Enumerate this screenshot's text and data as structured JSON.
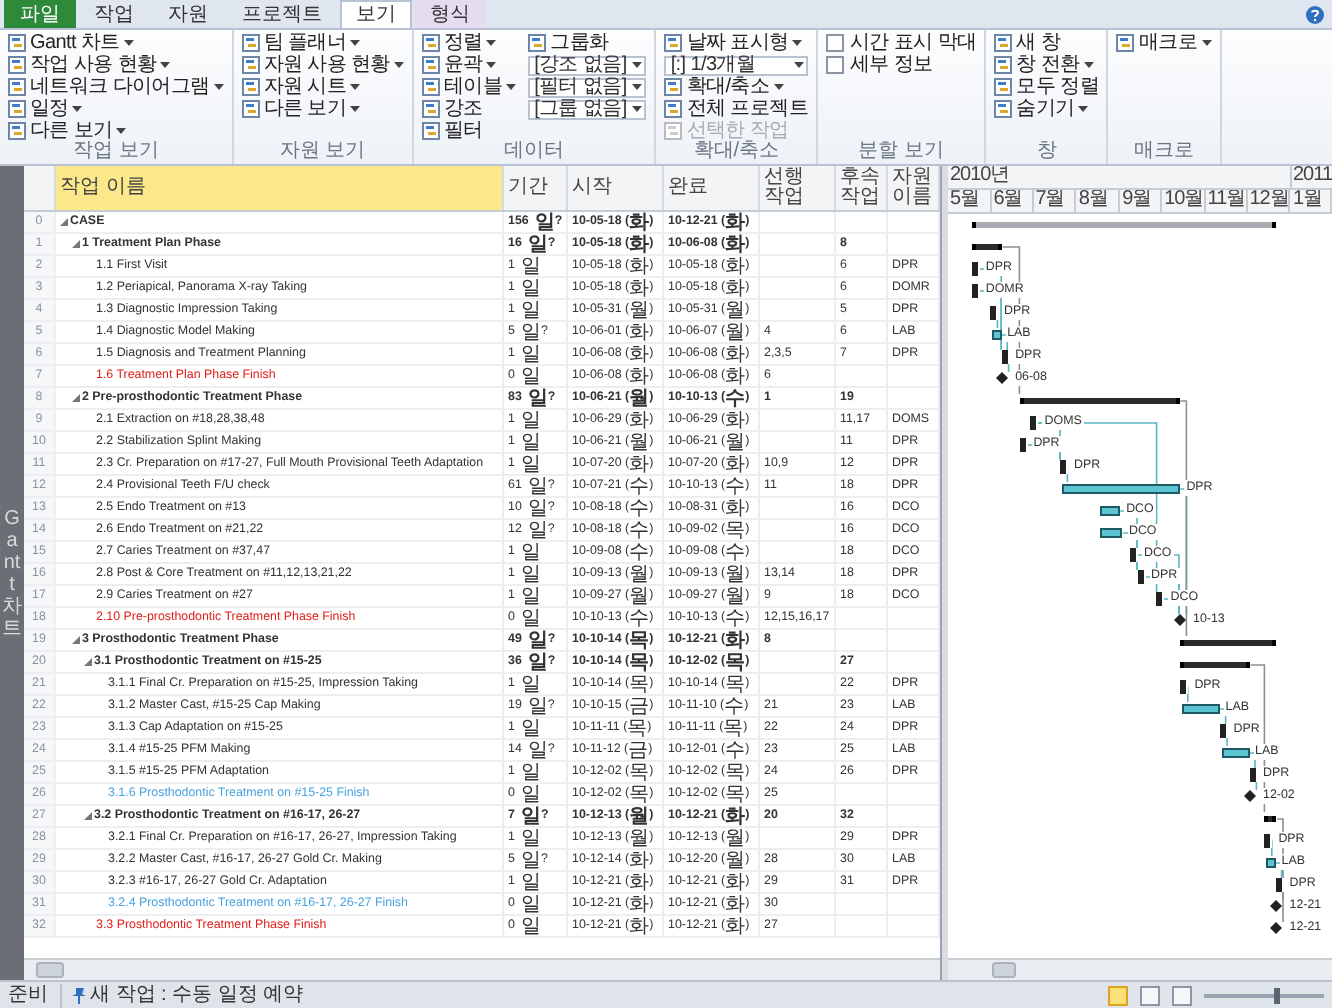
{
  "ribbon": {
    "tabs": [
      {
        "label": "파일",
        "kind": "file",
        "selected": false
      },
      {
        "label": "작업",
        "kind": "tab",
        "selected": false
      },
      {
        "label": "자원",
        "kind": "tab",
        "selected": false
      },
      {
        "label": "프로젝트",
        "kind": "tab",
        "selected": false
      },
      {
        "label": "보기",
        "kind": "tab",
        "selected": true
      },
      {
        "label": "형식",
        "kind": "contextual",
        "selected": false
      }
    ],
    "groups": [
      {
        "label": "작업 보기",
        "items": [
          {
            "label": "Gantt 차트",
            "kind": "dropdown",
            "disabled": false
          },
          {
            "label": "작업 사용 현황",
            "kind": "dropdown",
            "disabled": false
          },
          {
            "label": "네트워크 다이어그램",
            "kind": "dropdown",
            "disabled": false
          },
          {
            "label": "일정",
            "kind": "dropdown",
            "disabled": false
          },
          {
            "label": "다른 보기",
            "kind": "dropdown",
            "disabled": false
          }
        ]
      },
      {
        "label": "자원 보기",
        "items": [
          {
            "label": "팀 플래너",
            "kind": "dropdown",
            "disabled": false
          },
          {
            "label": "자원 사용 현황",
            "kind": "dropdown",
            "disabled": false
          },
          {
            "label": "자원 시트",
            "kind": "dropdown",
            "disabled": false
          },
          {
            "label": "다른 보기",
            "kind": "dropdown",
            "disabled": false
          }
        ]
      },
      {
        "label": "데이터",
        "items": [
          {
            "label": "정렬",
            "kind": "dropdown",
            "disabled": false
          },
          {
            "label": "윤곽",
            "kind": "dropdown",
            "disabled": false
          },
          {
            "label": "테이블",
            "kind": "dropdown",
            "disabled": false
          },
          {
            "label": "강조",
            "kind": "button",
            "disabled": false
          },
          {
            "label": "필터",
            "kind": "button",
            "disabled": false
          },
          {
            "label": "그룹화",
            "kind": "button",
            "disabled": false
          },
          {
            "label": "[강조 없음]",
            "kind": "field",
            "disabled": false
          },
          {
            "label": "[필터 없음]",
            "kind": "field",
            "disabled": false
          },
          {
            "label": "[그룹 없음]",
            "kind": "field",
            "disabled": false
          }
        ]
      },
      {
        "label": "확대/축소",
        "items": [
          {
            "label": "날짜 표시형",
            "kind": "dropdown",
            "disabled": false
          },
          {
            "label": "[:] 1/3개월",
            "kind": "field",
            "disabled": false
          },
          {
            "label": "확대/축소",
            "kind": "dropdown",
            "disabled": false
          },
          {
            "label": "전체 프로젝트",
            "kind": "button",
            "disabled": false
          },
          {
            "label": "선택한 작업",
            "kind": "button",
            "disabled": true
          }
        ]
      },
      {
        "label": "분할 보기",
        "items": [
          {
            "label": "시간 표시 막대",
            "kind": "checkbox",
            "checked": false,
            "disabled": false
          },
          {
            "label": "세부 정보",
            "kind": "checkbox",
            "checked": false,
            "disabled": false
          }
        ]
      },
      {
        "label": "창",
        "items": [
          {
            "label": "새 창",
            "kind": "button",
            "disabled": false
          },
          {
            "label": "창 전환",
            "kind": "dropdown",
            "disabled": false
          },
          {
            "label": "모두 정렬",
            "kind": "button",
            "disabled": false
          },
          {
            "label": "숨기기",
            "kind": "dropdown",
            "disabled": false
          }
        ]
      },
      {
        "label": "매크로",
        "items": [
          {
            "label": "매크로",
            "kind": "dropdown",
            "disabled": false
          }
        ]
      }
    ]
  },
  "side_label": "Gantt 차트",
  "task_table": {
    "columns": [
      {
        "label": "작업 이름",
        "selected": true
      },
      {
        "label": "기간",
        "selected": false
      },
      {
        "label": "시작",
        "selected": false
      },
      {
        "label": "완료",
        "selected": false
      },
      {
        "label": "선행 작업",
        "selected": false
      },
      {
        "label": "후속 작업",
        "selected": false
      },
      {
        "label": "자원 이름",
        "selected": false
      }
    ],
    "rows": [
      {
        "id": "0",
        "name": "CASE",
        "kind": "summary",
        "expanded": true,
        "duration": "156 일?",
        "start": "10-05-18 (화)",
        "finish": "10-12-21 (화)",
        "children": [
          {
            "id": "1",
            "name": "1 Treatment Plan Phase",
            "kind": "summary",
            "expanded": true,
            "duration": "16 일?",
            "start": "10-05-18 (화)",
            "finish": "10-06-08 (화)",
            "successors": "8",
            "children": [
              {
                "id": "2",
                "name": "1.1 First Visit",
                "kind": "task",
                "duration": "1 일",
                "start": "10-05-18 (화)",
                "finish": "10-05-18 (화)",
                "successors": "6",
                "resource": "DPR",
                "bar_label": "DPR"
              },
              {
                "id": "3",
                "name": "1.2 Periapical, Panorama X-ray Taking",
                "kind": "task",
                "duration": "1 일",
                "start": "10-05-18 (화)",
                "finish": "10-05-18 (화)",
                "successors": "6",
                "resource": "DOMR",
                "bar_label": "DOMR"
              },
              {
                "id": "4",
                "name": "1.3 Diagnostic Impression Taking",
                "kind": "task",
                "duration": "1 일",
                "start": "10-05-31 (월)",
                "finish": "10-05-31 (월)",
                "successors": "5",
                "resource": "DPR",
                "bar_label": "DPR"
              },
              {
                "id": "5",
                "name": "1.4 Diagnostic Model Making",
                "kind": "task",
                "duration": "5 일?",
                "start": "10-06-01 (화)",
                "finish": "10-06-07 (월)",
                "predecessors": "4",
                "successors": "6",
                "resource": "LAB",
                "bar_label": "LAB"
              },
              {
                "id": "6",
                "name": "1.5 Diagnosis and Treatment Planning",
                "kind": "task",
                "duration": "1 일",
                "start": "10-06-08 (화)",
                "finish": "10-06-08 (화)",
                "predecessors": "2,3,5",
                "successors": "7",
                "resource": "DPR",
                "bar_label": "DPR"
              },
              {
                "id": "7",
                "name": "1.6 Treatment Plan Phase Finish",
                "kind": "milestone",
                "color": "#e0201c",
                "duration": "0 일",
                "start": "10-06-08 (화)",
                "finish": "10-06-08 (화)",
                "predecessors": "6",
                "bar_label": "06-08"
              }
            ]
          },
          {
            "id": "8",
            "name": "2 Pre-prosthodontic Treatment Phase",
            "kind": "summary",
            "expanded": true,
            "duration": "83 일?",
            "start": "10-06-21 (월)",
            "finish": "10-10-13 (수)",
            "predecessors": "1",
            "successors": "19",
            "children": [
              {
                "id": "9",
                "name": "2.1 Extraction on #18,28,38,48",
                "kind": "task",
                "duration": "1 일",
                "start": "10-06-29 (화)",
                "finish": "10-06-29 (화)",
                "successors": "11,17",
                "resource": "DOMS",
                "bar_label": "DOMS"
              },
              {
                "id": "10",
                "name": "2.2 Stabilization Splint Making",
                "kind": "task",
                "duration": "1 일",
                "start": "10-06-21 (월)",
                "finish": "10-06-21 (월)",
                "successors": "11",
                "resource": "DPR",
                "bar_label": "DPR"
              },
              {
                "id": "11",
                "name": "2.3 Cr. Preparation on #17-27, Full Mouth Provisional Teeth Adaptation",
                "kind": "task",
                "duration": "1 일",
                "start": "10-07-20 (화)",
                "finish": "10-07-20 (화)",
                "predecessors": "10,9",
                "successors": "12",
                "resource": "DPR",
                "bar_label": "DPR"
              },
              {
                "id": "12",
                "name": "2.4 Provisional Teeth F/U check",
                "kind": "task",
                "duration": "61 일?",
                "start": "10-07-21 (수)",
                "finish": "10-10-13 (수)",
                "predecessors": "11",
                "successors": "18",
                "resource": "DPR",
                "bar_label": "DPR"
              },
              {
                "id": "13",
                "name": "2.5 Endo Treatment on #13",
                "kind": "task",
                "duration": "10 일?",
                "start": "10-08-18 (수)",
                "finish": "10-08-31 (화)",
                "successors": "16",
                "resource": "DCO",
                "bar_label": "DCO"
              },
              {
                "id": "14",
                "name": "2.6 Endo Treatment on #21,22",
                "kind": "task",
                "duration": "12 일?",
                "start": "10-08-18 (수)",
                "finish": "10-09-02 (목)",
                "successors": "16",
                "resource": "DCO",
                "bar_label": "DCO"
              },
              {
                "id": "15",
                "name": "2.7 Caries Treatment on #37,47",
                "kind": "task",
                "duration": "1 일",
                "start": "10-09-08 (수)",
                "finish": "10-09-08 (수)",
                "successors": "18",
                "resource": "DCO",
                "bar_label": "DCO"
              },
              {
                "id": "16",
                "name": "2.8 Post & Core Treatment on #11,12,13,21,22",
                "kind": "task",
                "duration": "1 일",
                "start": "10-09-13 (월)",
                "finish": "10-09-13 (월)",
                "predecessors": "13,14",
                "successors": "18",
                "resource": "DPR",
                "bar_label": "DPR"
              },
              {
                "id": "17",
                "name": "2.9 Caries Treatment on #27",
                "kind": "task",
                "duration": "1 일",
                "start": "10-09-27 (월)",
                "finish": "10-09-27 (월)",
                "predecessors": "9",
                "successors": "18",
                "resource": "DCO",
                "bar_label": "DCO"
              },
              {
                "id": "18",
                "name": "2.10 Pre-prosthodontic Treatment Phase Finish",
                "kind": "milestone",
                "color": "#e0201c",
                "duration": "0 일",
                "start": "10-10-13 (수)",
                "finish": "10-10-13 (수)",
                "predecessors": "12,15,16,17",
                "bar_label": "10-13"
              }
            ]
          },
          {
            "id": "19",
            "name": "3 Prosthodontic Treatment Phase",
            "kind": "summary",
            "expanded": true,
            "duration": "49 일?",
            "start": "10-10-14 (목)",
            "finish": "10-12-21 (화)",
            "predecessors": "8",
            "children": [
              {
                "id": "20",
                "name": "3.1 Prosthodontic Treatment on #15-25",
                "kind": "summary",
                "expanded": true,
                "duration": "36 일?",
                "start": "10-10-14 (목)",
                "finish": "10-12-02 (목)",
                "successors": "27",
                "children": [
                  {
                    "id": "21",
                    "name": "3.1.1 Final Cr. Preparation on #15-25, Impression Taking",
                    "kind": "task",
                    "duration": "1 일",
                    "start": "10-10-14 (목)",
                    "finish": "10-10-14 (목)",
                    "successors": "22",
                    "resource": "DPR",
                    "bar_label": "DPR"
                  },
                  {
                    "id": "22",
                    "name": "3.1.2 Master Cast, #15-25 Cap Making",
                    "kind": "task",
                    "duration": "19 일?",
                    "start": "10-10-15 (금)",
                    "finish": "10-11-10 (수)",
                    "predecessors": "21",
                    "successors": "23",
                    "resource": "LAB",
                    "bar_label": "LAB"
                  },
                  {
                    "id": "23",
                    "name": "3.1.3 Cap Adaptation on #15-25",
                    "kind": "task",
                    "duration": "1 일",
                    "start": "10-11-11 (목)",
                    "finish": "10-11-11 (목)",
                    "predecessors": "22",
                    "successors": "24",
                    "resource": "DPR",
                    "bar_label": "DPR"
                  },
                  {
                    "id": "24",
                    "name": "3.1.4 #15-25 PFM Making",
                    "kind": "task",
                    "duration": "14 일?",
                    "start": "10-11-12 (금)",
                    "finish": "10-12-01 (수)",
                    "predecessors": "23",
                    "successors": "25",
                    "resource": "LAB",
                    "bar_label": "LAB"
                  },
                  {
                    "id": "25",
                    "name": "3.1.5 #15-25 PFM Adaptation",
                    "kind": "task",
                    "duration": "1 일",
                    "start": "10-12-02 (목)",
                    "finish": "10-12-02 (목)",
                    "predecessors": "24",
                    "successors": "26",
                    "resource": "DPR",
                    "bar_label": "DPR"
                  },
                  {
                    "id": "26",
                    "name": "3.1.6 Prosthodontic Treatment on #15-25 Finish",
                    "kind": "milestone",
                    "color": "#4aa3e0",
                    "duration": "0 일",
                    "start": "10-12-02 (목)",
                    "finish": "10-12-02 (목)",
                    "predecessors": "25",
                    "bar_label": "12-02"
                  }
                ]
              },
              {
                "id": "27",
                "name": "3.2 Prosthodontic Treatment on #16-17, 26-27",
                "kind": "summary",
                "expanded": true,
                "duration": "7 일?",
                "start": "10-12-13 (월)",
                "finish": "10-12-21 (화)",
                "predecessors": "20",
                "successors": "32",
                "children": [
                  {
                    "id": "28",
                    "name": "3.2.1 Final Cr. Preparation on #16-17, 26-27, Impression Taking",
                    "kind": "task",
                    "duration": "1 일",
                    "start": "10-12-13 (월)",
                    "finish": "10-12-13 (월)",
                    "successors": "29",
                    "resource": "DPR",
                    "bar_label": "DPR"
                  },
                  {
                    "id": "29",
                    "name": "3.2.2 Master Cast, #16-17, 26-27 Gold Cr. Making",
                    "kind": "task",
                    "duration": "5 일?",
                    "start": "10-12-14 (화)",
                    "finish": "10-12-20 (월)",
                    "predecessors": "28",
                    "successors": "30",
                    "resource": "LAB",
                    "bar_label": "LAB"
                  },
                  {
                    "id": "30",
                    "name": "3.2.3 #16-17, 26-27 Gold Cr. Adaptation",
                    "kind": "task",
                    "duration": "1 일",
                    "start": "10-12-21 (화)",
                    "finish": "10-12-21 (화)",
                    "predecessors": "29",
                    "successors": "31",
                    "resource": "DPR",
                    "bar_label": "DPR"
                  },
                  {
                    "id": "31",
                    "name": "3.2.4 Prosthodontic Treatment on #16-17, 26-27 Finish",
                    "kind": "milestone",
                    "color": "#4aa3e0",
                    "duration": "0 일",
                    "start": "10-12-21 (화)",
                    "finish": "10-12-21 (화)",
                    "predecessors": "30",
                    "bar_label": "12-21"
                  }
                ]
              },
              {
                "id": "32",
                "name": "3.3 Prosthodontic Treatment Phase Finish",
                "kind": "milestone",
                "color": "#e0201c",
                "duration": "0 일",
                "start": "10-12-21 (화)",
                "finish": "10-12-21 (화)",
                "predecessors": "27",
                "bar_label": "12-21"
              }
            ]
          }
        ]
      }
    ]
  },
  "timescale": {
    "years": [
      {
        "label": "2010년"
      },
      {
        "label": "2011"
      }
    ],
    "months": [
      {
        "label": "5월"
      },
      {
        "label": "6월"
      },
      {
        "label": "7월"
      },
      {
        "label": "8월"
      },
      {
        "label": "9월"
      },
      {
        "label": "10월"
      },
      {
        "label": "11월"
      },
      {
        "label": "12월"
      },
      {
        "label": "1월"
      }
    ]
  },
  "status_bar": {
    "mode": "준비",
    "new_tasks": "새 작업 : 수동 일정 예약",
    "zoom": {
      "level": 0.6
    }
  }
}
